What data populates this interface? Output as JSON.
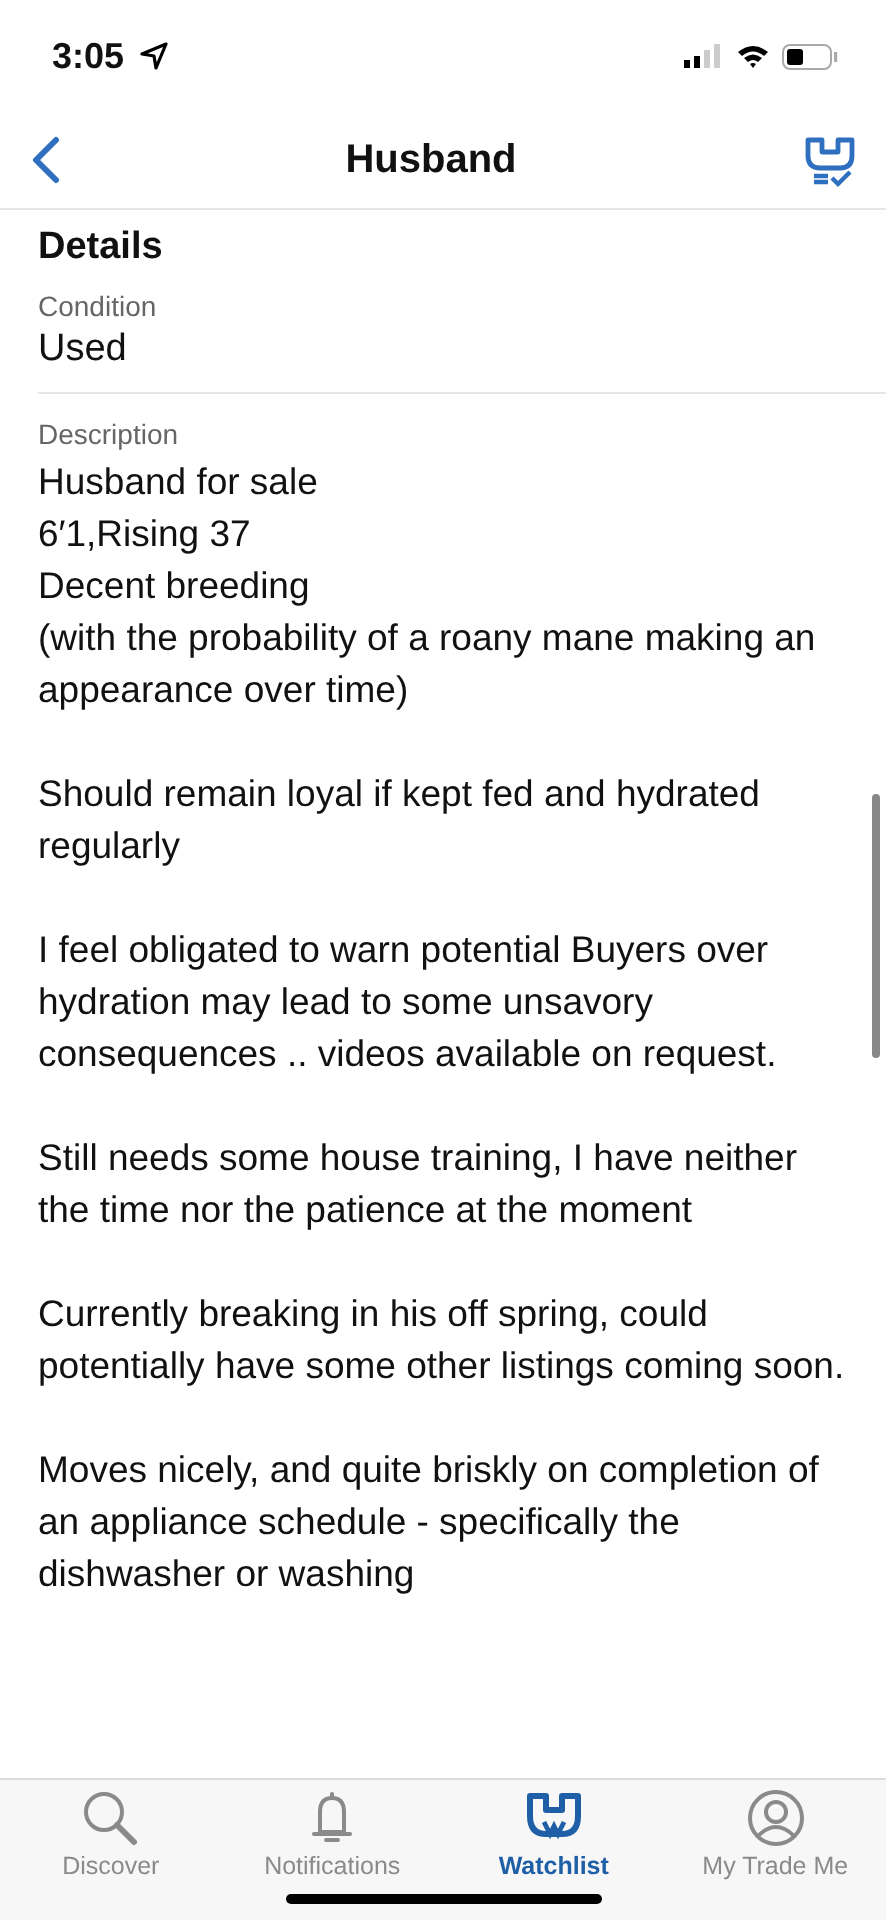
{
  "status_bar": {
    "time": "3:05"
  },
  "nav": {
    "title": "Husband"
  },
  "details": {
    "heading": "Details",
    "fields": [
      {
        "label": "Condition",
        "value": "Used"
      }
    ],
    "description": {
      "label": "Description",
      "paragraphs": [
        "Husband for sale\n6′1,Rising 37\nDecent breeding\n(with the probability of a roany mane making an appearance over time)",
        "Should remain loyal if kept fed and hydrated regularly",
        "I feel obligated to warn potential Buyers over hydration may lead to some unsavory consequences .. videos available on request.",
        "Still needs some house training, I have neither the time nor the patience at the moment",
        "Currently breaking in his off spring, could potentially have some other listings coming soon.",
        "Moves nicely, and quite briskly on completion of an appliance schedule - specifically the dishwasher or washing"
      ]
    }
  },
  "tabs": [
    {
      "kind": "search",
      "label": "Discover",
      "selected": false
    },
    {
      "kind": "bell",
      "label": "Notifications",
      "selected": false
    },
    {
      "kind": "binoculars",
      "label": "Watchlist",
      "selected": true
    },
    {
      "kind": "person",
      "label": "My Trade Me",
      "selected": false
    }
  ]
}
